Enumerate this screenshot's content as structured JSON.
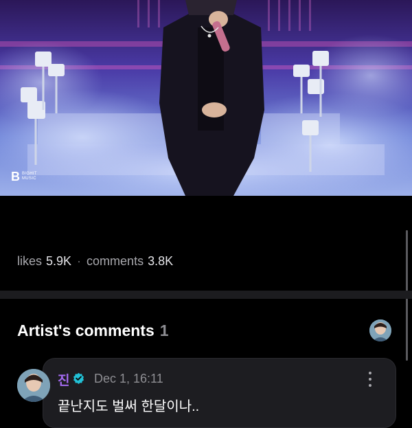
{
  "photo": {
    "watermark_line1": "BIGHIT",
    "watermark_line2": "MUSIC"
  },
  "stats": {
    "likes_label": "likes",
    "likes_value": "5.9K",
    "separator": "·",
    "comments_label": "comments",
    "comments_value": "3.8K"
  },
  "artist_comments": {
    "title": "Artist's comments",
    "count": "1",
    "items": [
      {
        "author": "진",
        "verified_icon": "verified-check-icon",
        "date": "Dec 1, 16:11",
        "text": "끝난지도 벌써 한달이나.."
      }
    ]
  },
  "colors": {
    "background": "#000000",
    "author_purple": "#a56bf2",
    "verified_teal": "#22c1d6",
    "muted_text": "#8e8e93"
  },
  "icons": {
    "more": "kebab-menu-icon",
    "avatar": "avatar"
  }
}
